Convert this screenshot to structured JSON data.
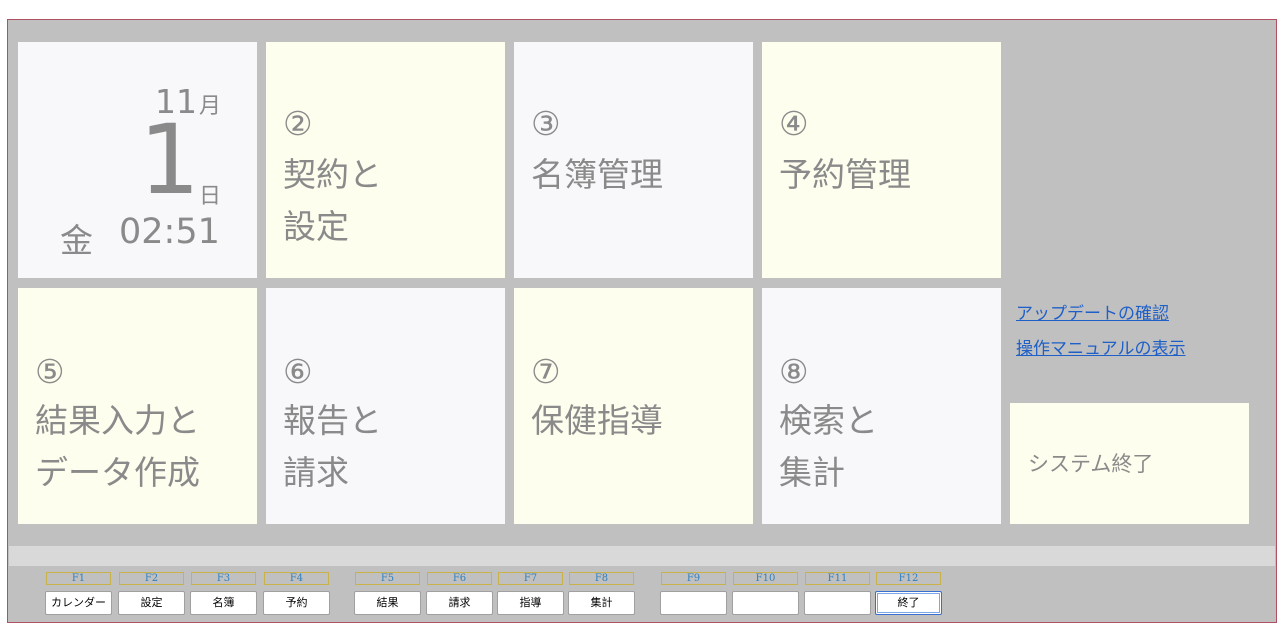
{
  "calendar": {
    "month": "11",
    "month_unit": "月",
    "day": "1",
    "day_unit": "日",
    "weekday": "金",
    "time": "02:51"
  },
  "tiles": [
    {
      "num": "②",
      "line1": "契約と",
      "line2": "設定"
    },
    {
      "num": "③",
      "line1": "名簿管理",
      "line2": ""
    },
    {
      "num": "④",
      "line1": "予約管理",
      "line2": ""
    },
    {
      "num": "⑤",
      "line1": "結果入力と",
      "line2": "データ作成"
    },
    {
      "num": "⑥",
      "line1": "報告と",
      "line2": "請求"
    },
    {
      "num": "⑦",
      "line1": "保健指導",
      "line2": ""
    },
    {
      "num": "⑧",
      "line1": "検索と",
      "line2": "集計"
    }
  ],
  "links": {
    "update": "アップデートの確認",
    "manual": "操作マニュアルの表示"
  },
  "exit_tile": {
    "label": "システム終了"
  },
  "function_keys": [
    {
      "key": "F1",
      "label": "カレンダー"
    },
    {
      "key": "F2",
      "label": "設定"
    },
    {
      "key": "F3",
      "label": "名簿"
    },
    {
      "key": "F4",
      "label": "予約"
    },
    {
      "key": "F5",
      "label": "結果"
    },
    {
      "key": "F6",
      "label": "請求"
    },
    {
      "key": "F7",
      "label": "指導"
    },
    {
      "key": "F8",
      "label": "集計"
    },
    {
      "key": "F9",
      "label": ""
    },
    {
      "key": "F10",
      "label": ""
    },
    {
      "key": "F11",
      "label": ""
    },
    {
      "key": "F12",
      "label": "終了"
    }
  ],
  "colors": {
    "background": "#c0c0c0",
    "tile_cream": "#fefeee",
    "tile_lavender": "#f8f7fa",
    "tile_text": "#8a8a8a",
    "link": "#1e5fc8",
    "fkey_text": "#2f7fbf"
  }
}
